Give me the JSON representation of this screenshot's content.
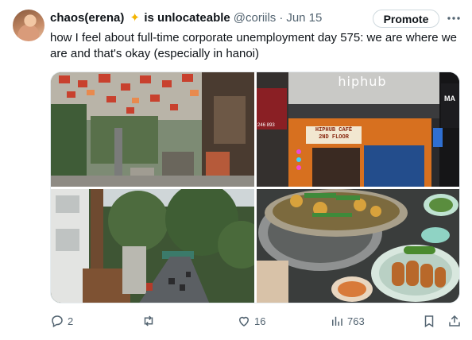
{
  "author": {
    "display_name": "chaos(erena)",
    "emoji_icon": "sparkle-star",
    "status_text": "is unlocateable",
    "handle": "@coriils",
    "separator": "·",
    "date": "Jun 15"
  },
  "promote_label": "Promote",
  "more_icon": "more-horizontal-icon",
  "tweet_text": "how I feel about full-time corporate unemployment day 575: we are where we are and that's okay (especially in hanoi)",
  "photos": {
    "photo2": {
      "sign_main": "hiphub",
      "sign_cafe_line1": "HIPHUB CAFÉ",
      "sign_cafe_line2": "2ND FLOOR",
      "side_sign": "MA",
      "phone_fragment": "246 893"
    }
  },
  "actions": {
    "replies": "2",
    "retweets": "",
    "likes": "16",
    "views": "763"
  },
  "colors": {
    "text": "#0f1419",
    "muted": "#536471",
    "border": "#cfd9de"
  }
}
